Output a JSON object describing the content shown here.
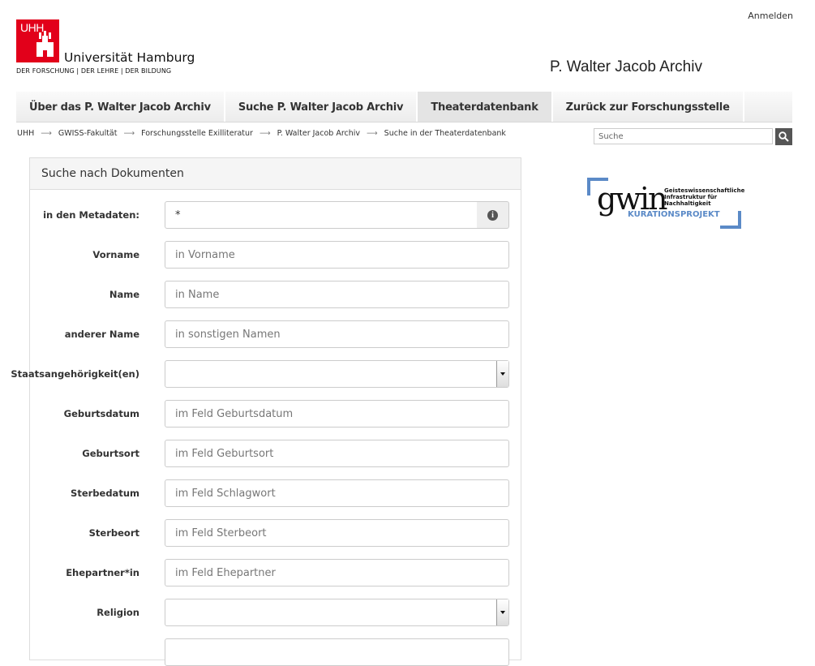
{
  "header": {
    "login": "Anmelden",
    "uni_logo_text": "UHH",
    "uni_name": "Universität Hamburg",
    "uni_tagline": "DER FORSCHUNG | DER LEHRE | DER BILDUNG",
    "site_title": "P. Walter Jacob Archiv"
  },
  "nav": [
    {
      "label": "Über das P. Walter Jacob Archiv",
      "active": false
    },
    {
      "label": "Suche P. Walter Jacob Archiv",
      "active": false
    },
    {
      "label": "Theaterdatenbank",
      "active": true
    },
    {
      "label": "Zurück zur Forschungsstelle",
      "active": false
    }
  ],
  "breadcrumb": [
    "UHH",
    "GWISS-Fakultät",
    "Forschungsstelle Exilliteratur",
    "P. Walter Jacob Archiv",
    "Suche in der Theaterdatenbank"
  ],
  "breadcrumb_separator": "⟶",
  "search": {
    "placeholder": "Suche"
  },
  "form": {
    "title": "Suche nach Dokumenten",
    "fields": [
      {
        "label": "in den Metadaten:",
        "value": "*",
        "placeholder": "",
        "type": "text-info"
      },
      {
        "label": "Vorname",
        "value": "",
        "placeholder": "in Vorname",
        "type": "text"
      },
      {
        "label": "Name",
        "value": "",
        "placeholder": "in Name",
        "type": "text"
      },
      {
        "label": "anderer Name",
        "value": "",
        "placeholder": "in sonstigen Namen",
        "type": "text"
      },
      {
        "label": "Staatsangehörigkeit(en)",
        "value": "",
        "placeholder": "",
        "type": "select"
      },
      {
        "label": "Geburtsdatum",
        "value": "",
        "placeholder": "im Feld Geburtsdatum",
        "type": "text"
      },
      {
        "label": "Geburtsort",
        "value": "",
        "placeholder": "im Feld Geburtsort",
        "type": "text"
      },
      {
        "label": "Sterbedatum",
        "value": "",
        "placeholder": "im Feld Schlagwort",
        "type": "text"
      },
      {
        "label": "Sterbeort",
        "value": "",
        "placeholder": "im Feld Sterbeort",
        "type": "text"
      },
      {
        "label": "Ehepartner*in",
        "value": "",
        "placeholder": "im Feld Ehepartner",
        "type": "text"
      },
      {
        "label": "Religion",
        "value": "",
        "placeholder": "",
        "type": "select"
      }
    ]
  },
  "gwin": {
    "logo": "gwin",
    "description": [
      "Geisteswissenschaftliche",
      "Infrastruktur für",
      "Nachhaltigkeit"
    ],
    "subtitle": "KURATIONSPROJEKT",
    "accent_color": "#5b8ac7"
  },
  "colors": {
    "brand_red": "#e2001a"
  }
}
